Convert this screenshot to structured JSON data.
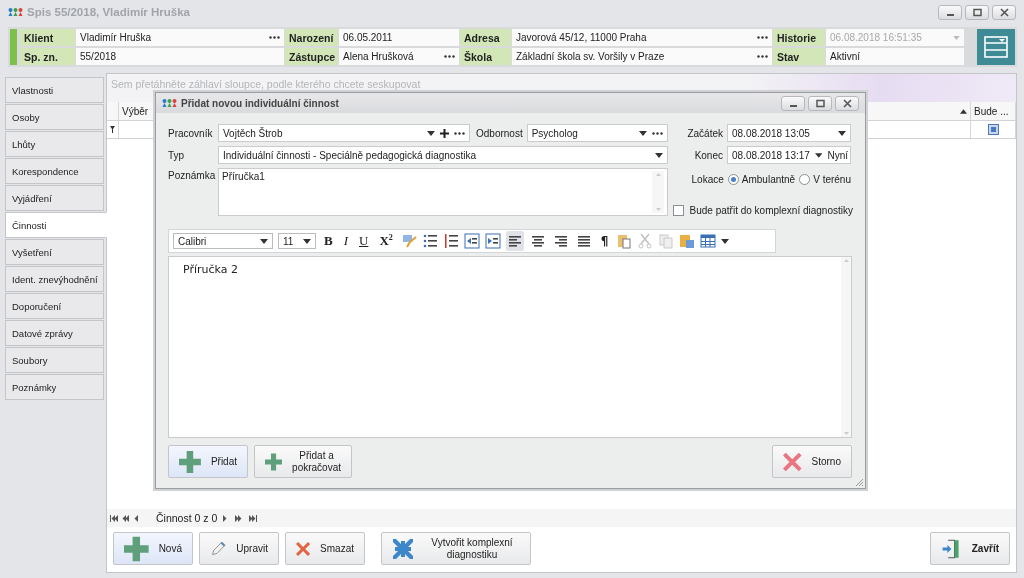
{
  "window": {
    "title": "Spis 55/2018, Vladimír Hruška"
  },
  "header": {
    "fields": [
      {
        "label": "Klient",
        "value": "Vladimír Hruška",
        "kind": "browse",
        "disabled": false
      },
      {
        "label": "Narození",
        "value": "06.05.2011",
        "kind": "text",
        "disabled": false
      },
      {
        "label": "Adresa",
        "value": "Javorová 45/12, 11000 Praha",
        "kind": "browse",
        "disabled": false
      },
      {
        "label": "Historie",
        "value": "06.08.2018 16:51:35",
        "kind": "dropdown",
        "disabled": true
      },
      {
        "label": "Sp. zn.",
        "value": "55/2018",
        "kind": "text",
        "disabled": false
      },
      {
        "label": "Zástupce",
        "value": "Alena Hrušková",
        "kind": "browse",
        "disabled": false
      },
      {
        "label": "Škola",
        "value": "Základní škola sv. Voršily v Praze",
        "kind": "browse",
        "disabled": false
      },
      {
        "label": "Stav",
        "value": "Aktivní",
        "kind": "text",
        "disabled": false
      }
    ]
  },
  "tabs": [
    {
      "label": "Vlastnosti",
      "selected": false
    },
    {
      "label": "Osoby",
      "selected": false
    },
    {
      "label": "Lhůty",
      "selected": false
    },
    {
      "label": "Korespondence",
      "selected": false
    },
    {
      "label": "Vyjádření",
      "selected": false
    },
    {
      "label": "Činnosti",
      "selected": true
    },
    {
      "label": "Vyšetření",
      "selected": false
    },
    {
      "label": "Ident. znevýhodnění",
      "selected": false
    },
    {
      "label": "Doporučení",
      "selected": false
    },
    {
      "label": "Datové zprávy",
      "selected": false
    },
    {
      "label": "Soubory",
      "selected": false
    },
    {
      "label": "Poznámky",
      "selected": false
    }
  ],
  "grid": {
    "group_panel": "Sem přetáhněte záhlaví sloupce, podle kterého chcete seskupovat",
    "columns": [
      {
        "label": "Výběr"
      },
      {
        "label": "Bude ..."
      }
    ],
    "navigator": "Činnost 0 z 0"
  },
  "buttons": [
    {
      "label": "Nová",
      "kind": "add"
    },
    {
      "label": "Upravit",
      "kind": "edit"
    },
    {
      "label": "Smazat",
      "kind": "delete"
    },
    {
      "label": "Vytvořit komplexní diagnostiku",
      "kind": "merge"
    },
    {
      "label": "Zavřít",
      "kind": "close"
    }
  ],
  "dialog": {
    "title": "Přidat novou individuální činnost",
    "worker": {
      "label": "Pracovník",
      "value": "Vojtěch Štrob"
    },
    "specialty": {
      "label": "Odbornost",
      "value": "Psycholog"
    },
    "start": {
      "label": "Začátek",
      "value": "08.08.2018 13:05"
    },
    "type": {
      "label": "Typ",
      "value": "Individuální činnosti - Speciálně pedagogická diagnostika"
    },
    "end": {
      "label": "Konec",
      "value": "08.08.2018 13:17",
      "now": "Nyní"
    },
    "note": {
      "label": "Poznámka",
      "value": "Příručka1"
    },
    "location": {
      "label": "Lokace",
      "options": [
        {
          "label": "Ambulantně",
          "selected": true
        },
        {
          "label": "V terénu",
          "selected": false
        }
      ]
    },
    "complex": {
      "label": "Bude patřit do komplexní diagnostiky",
      "checked": false
    },
    "editor": {
      "font": "Calibri",
      "size": "11",
      "format": [
        "B",
        "I",
        "U",
        "X$^{2}$"
      ],
      "pilcrow": "¶",
      "alignment": [
        {
          "kind": "left",
          "selected": true
        },
        {
          "kind": "center",
          "selected": false
        },
        {
          "kind": "right",
          "selected": false
        },
        {
          "kind": "justify",
          "selected": false
        }
      ],
      "text": "Příručka 2"
    },
    "buttons": [
      {
        "label": "Přidat",
        "kind": "add"
      },
      {
        "label": "Přidat a pokračovat",
        "kind": "add"
      },
      {
        "label": "Storno",
        "kind": "cancel"
      }
    ]
  }
}
